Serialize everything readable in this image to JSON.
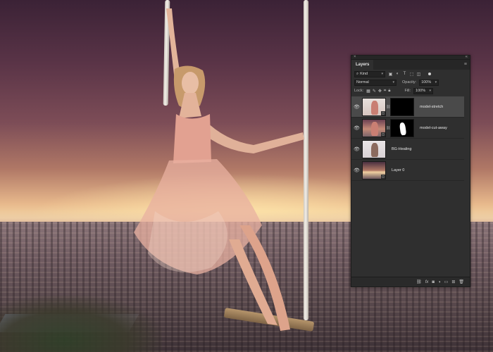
{
  "panel": {
    "close_glyph": "×",
    "collapse_glyph": "«",
    "menu_glyph": "≡",
    "tab_label": "Layers",
    "filter": {
      "kind_label": "Kind",
      "icons": [
        "pixel-filter-icon",
        "adjustment-filter-icon",
        "type-filter-icon",
        "shape-filter-icon",
        "smart-object-filter-icon"
      ]
    },
    "blend_mode": "Normal",
    "opacity_label": "Opacity:",
    "opacity_value": "100%",
    "lock_label": "Lock:",
    "fill_label": "Fill:",
    "fill_value": "100%",
    "layers": [
      {
        "name": "model-stretch",
        "selected": true,
        "has_mask": true
      },
      {
        "name": "model-cut-away",
        "selected": false,
        "has_mask": true
      },
      {
        "name": "BG-Healing",
        "selected": false,
        "has_mask": false
      },
      {
        "name": "Layer 0",
        "selected": false,
        "has_mask": false
      }
    ],
    "footer_icons": [
      "link-layers-icon",
      "fx-icon",
      "add-mask-icon",
      "adjustment-layer-icon",
      "new-group-icon",
      "new-layer-icon",
      "trash-icon"
    ]
  },
  "colors": {
    "panel_bg": "#2f2f2f",
    "selected_row": "#4a4a4a",
    "text": "#e6e6e6"
  }
}
